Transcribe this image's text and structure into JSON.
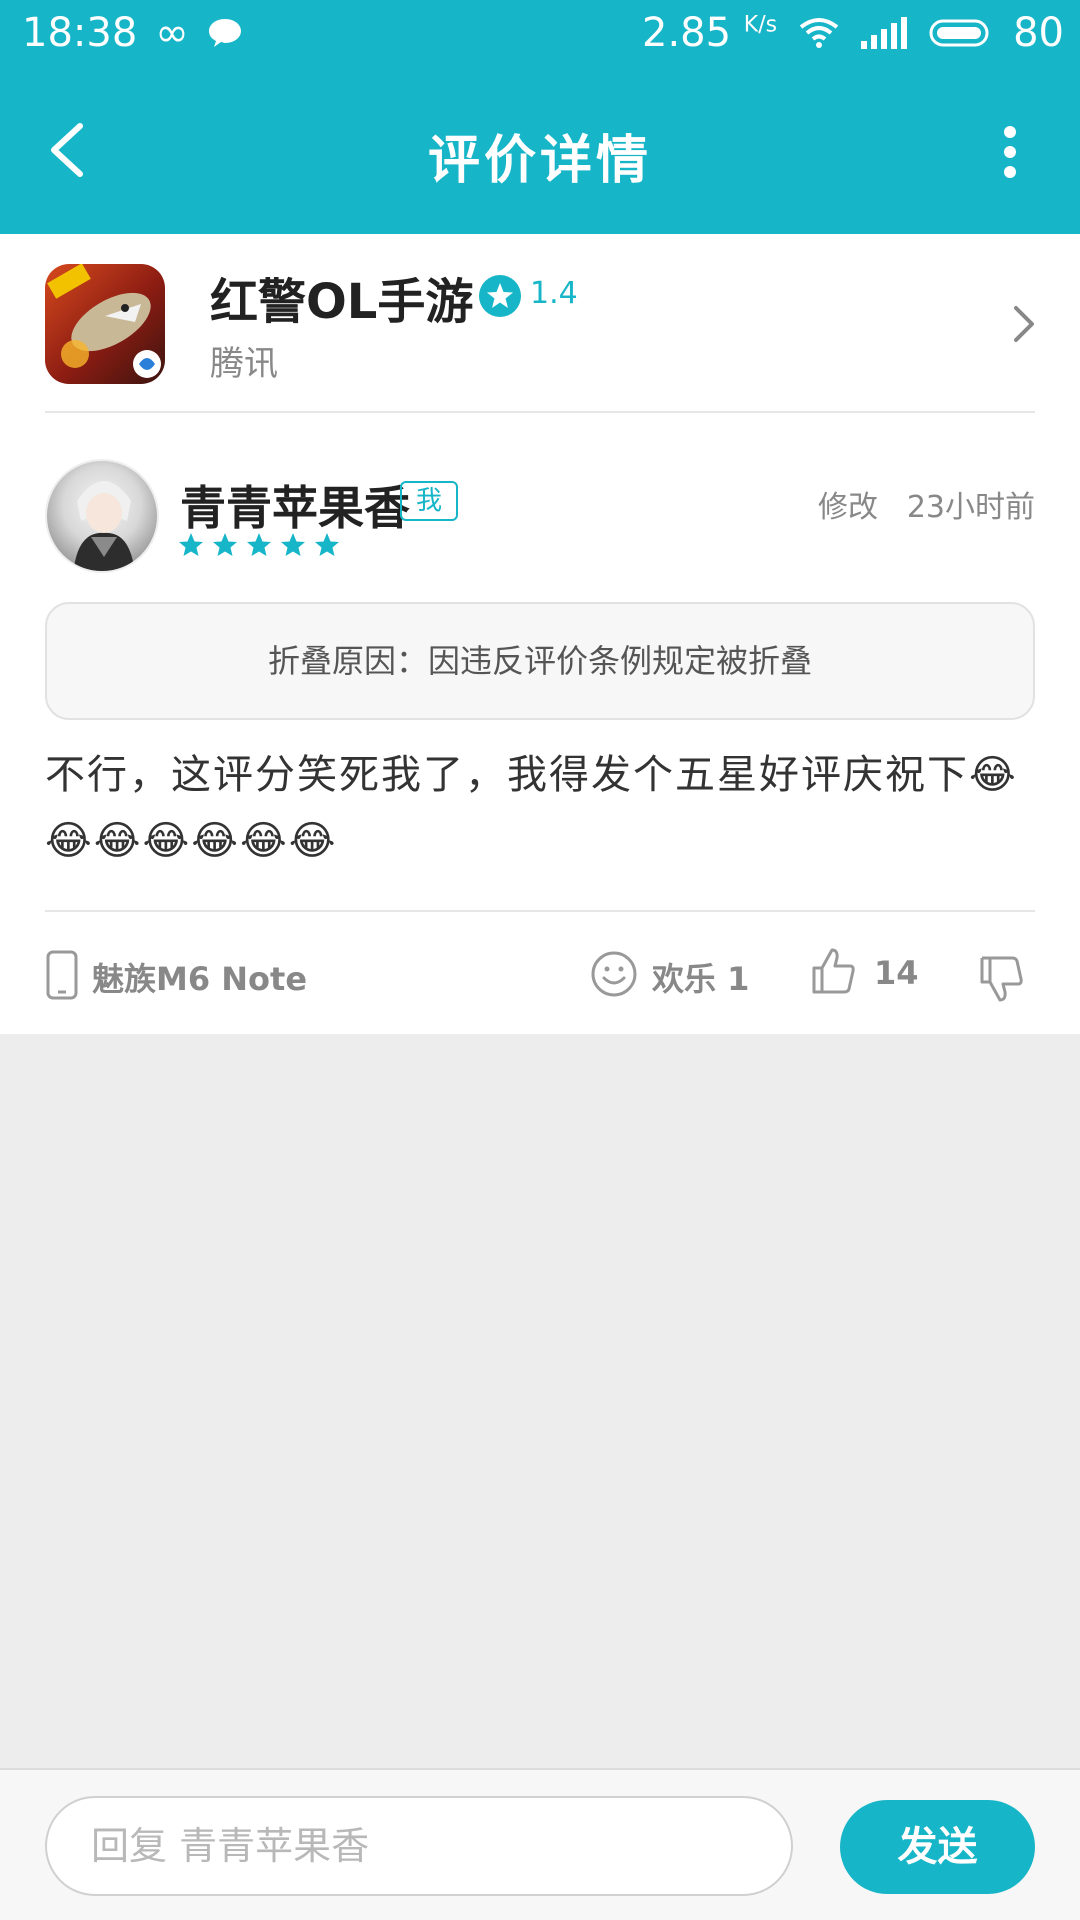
{
  "status_bar": {
    "time": "18:38",
    "speed": "2.85",
    "speed_unit": "K/s",
    "battery": "80"
  },
  "nav": {
    "title": "评价详情"
  },
  "app": {
    "name": "红警OL手游",
    "rating": "1.4",
    "developer": "腾讯"
  },
  "review": {
    "user_name": "青青苹果香",
    "me_badge": "我",
    "star_count": 5,
    "edit_label": "修改",
    "time": "23小时前",
    "fold_reason": "折叠原因：因违反评价条例规定被折叠",
    "text": "不行，这评分笑死我了，我得发个五星好评庆祝下😂😂😂😂😂😂😂",
    "device": "魅族M6 Note",
    "fun_label": "欢乐 1",
    "like_count": "14"
  },
  "reply": {
    "placeholder": "回复 青青苹果香",
    "send_label": "发送"
  },
  "colors": {
    "accent": "#17b5c8",
    "background": "#ededed"
  }
}
